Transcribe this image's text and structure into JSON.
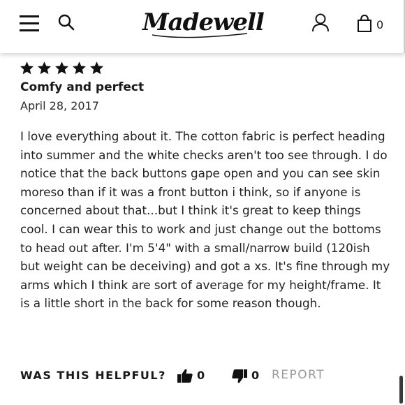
{
  "header": {
    "logo_text": "Madewell",
    "bag_count": "0",
    "icons": {
      "menu": "hamburger-menu-icon",
      "search": "search-icon",
      "account": "account-icon",
      "bag": "shopping-bag-icon"
    }
  },
  "review": {
    "rating": 5,
    "rating_max": 5,
    "title": "Comfy and perfect",
    "date": "April 28, 2017",
    "body": "I love everything about it. The cotton fabric is perfect heading into summer and the white checks aren't too see through. I do notice that the back buttons gape open and you can see skin moreso than if it was a front button i think, so if anyone is concerned about that...but I think it's great to keep things cool. I can wear this to work and just change out the bottoms to head out after. I'm 5'4\" with a small/narrow build (120ish but weight can be deceiving) and got a xs. It's fine through my arms which I think are sort of average for my height/frame. It is a little short in the back for some reason though."
  },
  "helpful": {
    "label": "WAS THIS HELPFUL?",
    "up_count": "0",
    "down_count": "0",
    "report_label": "REPORT"
  },
  "colors": {
    "text": "#1a1a1a",
    "muted": "#9a9a9a",
    "background": "#ffffff"
  }
}
